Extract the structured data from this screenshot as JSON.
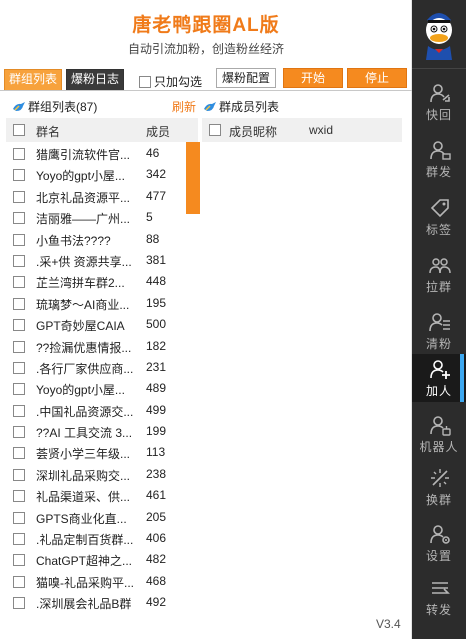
{
  "header": {
    "title": "唐老鸭跟圈AL版",
    "subtitle": "自动引流加粉，创造粉丝经济"
  },
  "toolbar": {
    "tab_groups": "群组列表",
    "tab_log": "爆粉日志",
    "only_checked": "只加勾选",
    "config_button": "爆粉配置",
    "start_button": "开始",
    "stop_button": "停止"
  },
  "groups": {
    "title": "群组列表(87)",
    "refresh": "刷新",
    "col_name": "群名",
    "col_members": "成员",
    "rows": [
      {
        "name": "猎鹰引流软件官...",
        "count": "46"
      },
      {
        "name": "Yoyo的gpt小屋...",
        "count": "342"
      },
      {
        "name": "北京礼品资源平...",
        "count": "477"
      },
      {
        "name": "洁丽雅——广州...",
        "count": "5"
      },
      {
        "name": "小鱼书法????",
        "count": "88"
      },
      {
        "name": ".采+供 资源共享...",
        "count": "381"
      },
      {
        "name": "芷兰湾拼车群2...",
        "count": "448"
      },
      {
        "name": "琉璃梦～AI商业...",
        "count": "195"
      },
      {
        "name": "GPT奇妙屋CAIA",
        "count": "500"
      },
      {
        "name": "??捡漏优惠情报...",
        "count": "182"
      },
      {
        "name": ".各行厂家供应商...",
        "count": "231"
      },
      {
        "name": "Yoyo的gpt小屋...",
        "count": "489"
      },
      {
        "name": ".中国礼品资源交...",
        "count": "499"
      },
      {
        "name": "??AI 工具交流 3...",
        "count": "199"
      },
      {
        "name": "荟贤小学三年级...",
        "count": "113"
      },
      {
        "name": "深圳礼品采购交...",
        "count": "238"
      },
      {
        "name": "礼品渠道采、供...",
        "count": "461"
      },
      {
        "name": "GPTS商业化直...",
        "count": "205"
      },
      {
        "name": ".礼品定制百货群...",
        "count": "406"
      },
      {
        "name": "ChatGPT超神之...",
        "count": "482"
      },
      {
        "name": "猫嗅-礼品采购平...",
        "count": "468"
      },
      {
        "name": ".深圳展会礼品B群",
        "count": "492"
      }
    ]
  },
  "members": {
    "title": "群成员列表",
    "col_nickname": "成员昵称",
    "col_wxid": "wxid"
  },
  "sidebar": {
    "items": [
      {
        "label": "快回",
        "icon": "user-quick-reply-icon"
      },
      {
        "label": "群发",
        "icon": "user-broadcast-icon"
      },
      {
        "label": "标签",
        "icon": "tag-icon"
      },
      {
        "label": "拉群",
        "icon": "users-pull-icon"
      },
      {
        "label": "清粉",
        "icon": "user-clean-icon"
      },
      {
        "label": "加人",
        "icon": "user-add-icon"
      },
      {
        "label": "机器人",
        "icon": "robot-icon"
      },
      {
        "label": "换群",
        "icon": "switch-group-icon"
      },
      {
        "label": "设置",
        "icon": "gear-user-icon"
      },
      {
        "label": "转发",
        "icon": "forward-icon"
      }
    ]
  },
  "version": "V3.4",
  "colors": {
    "accent": "#f58a1f",
    "sidebar_bg": "#2c2c2c",
    "active_indicator": "#3da8f0"
  }
}
